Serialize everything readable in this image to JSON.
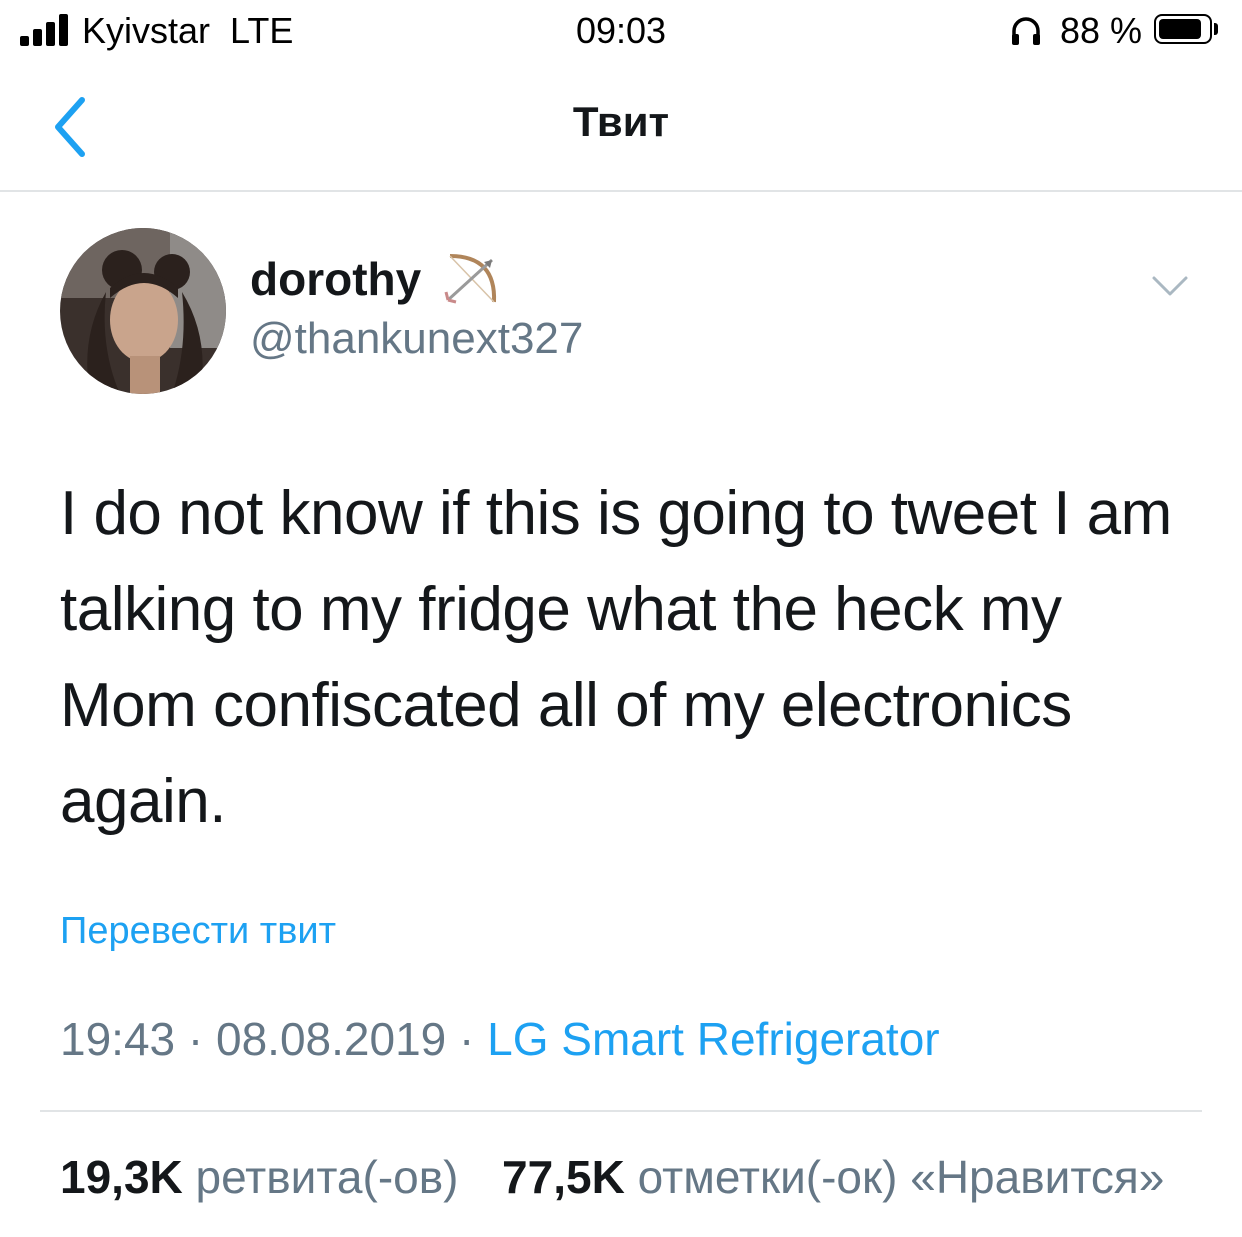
{
  "status_bar": {
    "carrier": "Kyivstar  LTE",
    "time": "09:03",
    "battery_percent": "88 %",
    "battery_level": 0.88,
    "signal_icon": "signal-bars-icon",
    "headphones_icon": "headphones-icon"
  },
  "nav": {
    "title": "Твит",
    "back_icon": "chevron-left-icon"
  },
  "tweet": {
    "author": {
      "display_name": "dorothy",
      "emoji_icon": "bow-and-arrow-icon",
      "handle": "@thankunext327"
    },
    "text": "I do not know if this is going to tweet I am talking to my fridge what the heck my Mom confiscated all of my electronics again.",
    "translate_label": "Перевести твит",
    "time": "19:43",
    "separator": " · ",
    "date": "08.08.2019",
    "source": "LG Smart Refrigerator",
    "retweets_count": "19,3K",
    "retweets_label": "ретвита(-ов)",
    "likes_count": "77,5K",
    "likes_label": "отметки(-ок) «Нравится»"
  },
  "colors": {
    "accent": "#1da1f2",
    "text": "#14171a",
    "secondary": "#657786",
    "divider": "#e1e4e6"
  }
}
